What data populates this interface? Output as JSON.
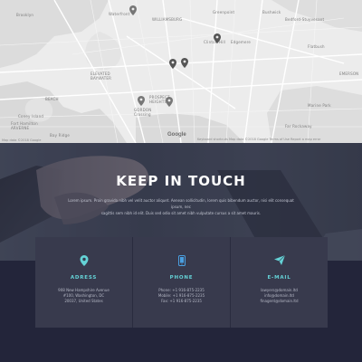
{
  "map": {
    "labels": [
      "Brooklyn",
      "Waterfront",
      "WILLIAMSBURG",
      "Greenpoint",
      "Bushwick",
      "Bedford-Stuyvesant",
      "Clinton Hill",
      "Flatbush",
      "ELEVATED",
      "BAYWATER",
      "PROSPECT",
      "HEIGHTS",
      "GORDON",
      "Crossing",
      "BEACH",
      "Marine Park",
      "Fort Hamilton",
      "Bay Ridge",
      "ARVERNE",
      "EMERSON",
      "Coney Island",
      "Far Rockaway",
      "Edgemere"
    ],
    "google_logo": "Google",
    "footer": "Keyboard shortcuts   Map data ©2018 Google   Terms of Use   Report a map error",
    "footer_left": "Map data ©2018 Google"
  },
  "hero": {
    "title": "KEEP IN TOUCH",
    "text_line1": "Lorem ipsum. Proin gravida nibh vel velit auctor aliquet. Aenean sollicitudin, lorem quis bibendum auctor, nisi elit consequat ipsum, nec",
    "text_line2": "sagittis sem nibh id elit. Duis sed odio sit amet nibh vulputate cursus a sit amet mauris."
  },
  "cards": [
    {
      "icon": "location-pin-icon",
      "title": "ADRESS",
      "lines": [
        "908 New Hampshire Avenue",
        "#100, Washington, DC",
        "20037, United States"
      ]
    },
    {
      "icon": "phone-icon",
      "title": "PHONE",
      "lines": [
        "Phone: +1 916-875-2235",
        "Mobile: +1 916-875-2235",
        "Fax: +1 916-875-2235"
      ]
    },
    {
      "icon": "paper-plane-icon",
      "title": "E-MAIL",
      "lines": [
        "lawyers@domain.ltd",
        "info@domain.ltd",
        "finagent@domain.ltd"
      ]
    }
  ],
  "colors": {
    "accent": "#64d2d6",
    "icon_blue": "#4a9fe0",
    "card_bg": "#383a4d",
    "page_bg": "#23253a"
  }
}
